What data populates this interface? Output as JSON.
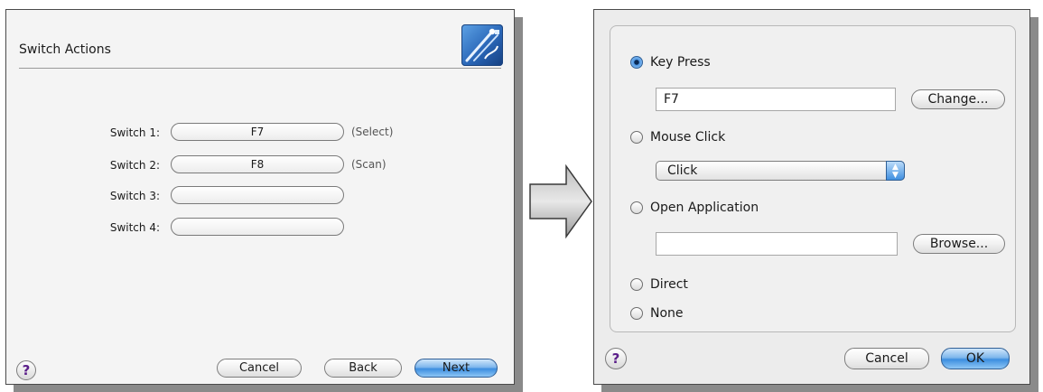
{
  "left_dialog": {
    "title": "Switch Actions",
    "logo_icon": "usb-switch-icon",
    "switches": [
      {
        "label": "Switch 1:",
        "value": "F7",
        "note": "(Select)"
      },
      {
        "label": "Switch 2:",
        "value": "F8",
        "note": "(Scan)"
      },
      {
        "label": "Switch 3:",
        "value": "",
        "note": ""
      },
      {
        "label": "Switch 4:",
        "value": "",
        "note": ""
      }
    ],
    "buttons": {
      "help": "?",
      "cancel": "Cancel",
      "back": "Back",
      "next": "Next"
    }
  },
  "arrow_icon": "right-arrow-icon",
  "right_dialog": {
    "options": {
      "key_press": {
        "label": "Key Press",
        "checked": true,
        "field_value": "F7",
        "button": "Change..."
      },
      "mouse_click": {
        "label": "Mouse Click",
        "checked": false,
        "popup_value": "Click"
      },
      "open_application": {
        "label": "Open Application",
        "checked": false,
        "field_value": "",
        "button": "Browse..."
      },
      "direct": {
        "label": "Direct",
        "checked": false
      },
      "none": {
        "label": "None",
        "checked": false
      }
    },
    "buttons": {
      "help": "?",
      "cancel": "Cancel",
      "ok": "OK"
    }
  },
  "colors": {
    "primary_button": "#3c8ee0",
    "help_glyph": "#5b1f8a",
    "shadow": "#8a8a8a"
  }
}
